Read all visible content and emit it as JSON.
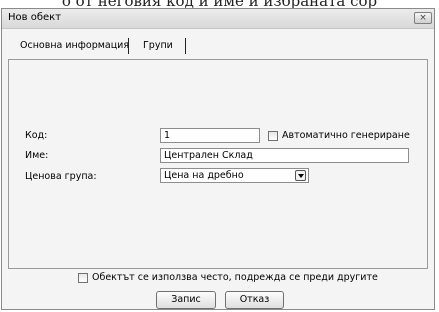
{
  "caption_fragment": "о от неговия код и име и избраната сор",
  "window": {
    "title": "Нов обект",
    "close_glyph": "×"
  },
  "tabs": [
    {
      "label": "Основна информация",
      "selected": true
    },
    {
      "label": "Групи",
      "selected": false
    }
  ],
  "form": {
    "code": {
      "label": "Код:",
      "value": "1"
    },
    "auto_generate": {
      "label": "Автоматично генериране",
      "checked": false
    },
    "name": {
      "label": "Име:",
      "value": "Централен Склад"
    },
    "price_group": {
      "label": "Ценова група:",
      "value": "Цена на дребно"
    }
  },
  "frequent_use": {
    "label": "Обектът се използва често, подрежда се преди другите",
    "checked": false
  },
  "buttons": {
    "save": "Запис",
    "cancel": "Отказ"
  },
  "icons": [
    "close-icon",
    "checkbox-icon",
    "chevron-down-icon"
  ]
}
